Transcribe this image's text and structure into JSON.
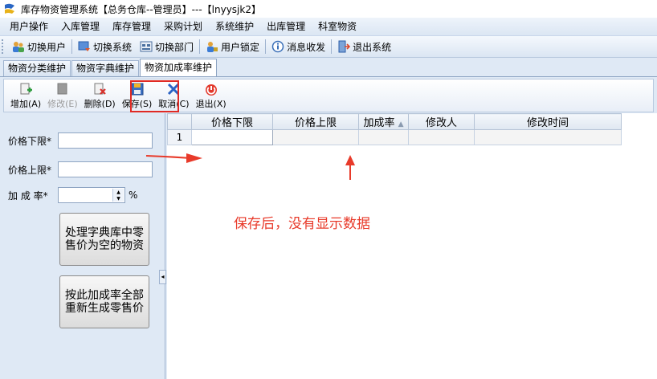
{
  "window": {
    "title": "库存物资管理系统【总务仓库--管理员】---【lnyysjk2】"
  },
  "menu": [
    "用户操作",
    "入库管理",
    "库存管理",
    "采购计划",
    "系统维护",
    "出库管理",
    "科室物资"
  ],
  "sysbar": [
    "切换用户",
    "切换系统",
    "切换部门",
    "用户锁定",
    "消息收发",
    "退出系统"
  ],
  "tabs": [
    "物资分类维护",
    "物资字典维护",
    "物资加成率维护"
  ],
  "toolbar": {
    "add": "增加(A)",
    "edit": "修改(E)",
    "delete": "删除(D)",
    "save": "保存(S)",
    "cancel": "取消(C)",
    "exit": "退出(X)"
  },
  "form": {
    "lower_label": "价格下限",
    "upper_label": "价格上限",
    "rate_label": "加 成 率",
    "required_mark": "*",
    "percent": "%",
    "btn_fix_dict": "处理字典库中零售价为空的物资",
    "btn_regen": "按此加成率全部重新生成零售价"
  },
  "grid": {
    "columns": [
      "价格下限",
      "价格上限",
      "加成率",
      "修改人",
      "修改时间"
    ],
    "sort_indicator": "▲",
    "rows": [
      {
        "num": "1",
        "cells": [
          "",
          "",
          "",
          "",
          ""
        ]
      }
    ]
  },
  "annotation": "保存后，没有显示数据",
  "colors": {
    "accent_red": "#e02a24",
    "annotation_red": "#e83a2a"
  }
}
